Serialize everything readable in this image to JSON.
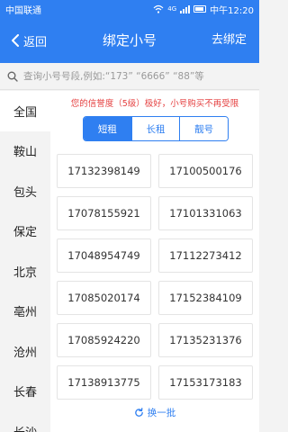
{
  "status_bar": {
    "carrier": "中国联通",
    "network": "4G",
    "time": "中午12:20"
  },
  "nav": {
    "back_label": "返回",
    "title": "绑定小号",
    "action_label": "去绑定"
  },
  "search": {
    "placeholder": "查询小号号段,例如:“173” “6666” “88”等"
  },
  "sidebar": {
    "cities": [
      "全国",
      "鞍山",
      "包头",
      "保定",
      "北京",
      "亳州",
      "沧州",
      "长春",
      "长沙"
    ],
    "selected": "全国"
  },
  "notice": "您的信誉度（5级）极好，小号购买不再受限",
  "tabs": {
    "items": [
      "短租",
      "长租",
      "靓号"
    ],
    "selected": "短租"
  },
  "numbers": [
    "17132398149",
    "17100500176",
    "17078155921",
    "17101331063",
    "17048954749",
    "17112273412",
    "17085020174",
    "17152384109",
    "17085924220",
    "17135231376",
    "17138913775",
    "17153173183"
  ],
  "refresh_label": "换一批",
  "colors": {
    "primary": "#2f7ff1",
    "notice": "#e54040"
  }
}
